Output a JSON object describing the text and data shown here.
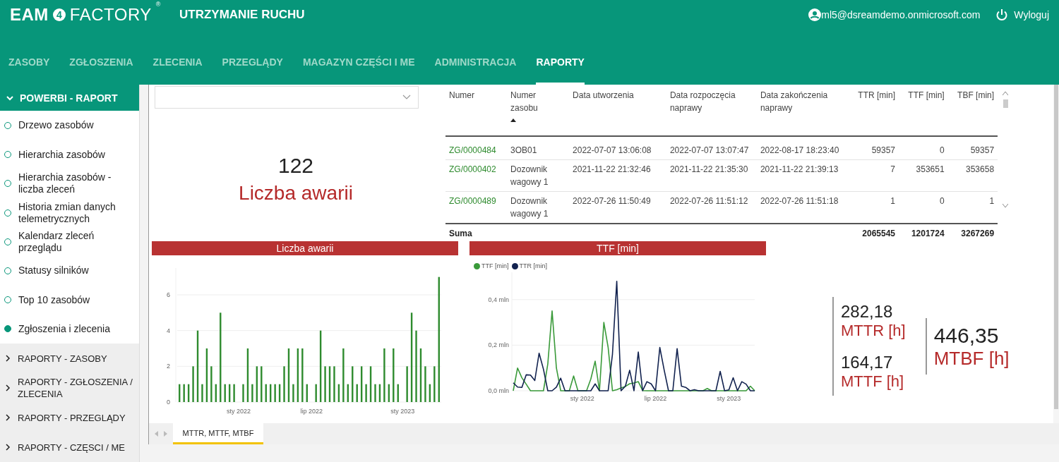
{
  "header": {
    "logo": {
      "left": "EAM",
      "mark": "4",
      "right": "FACTORY",
      "registered": "®"
    },
    "title": "UTRZYMANIE RUCHU",
    "user": "ml5@dsreamdemo.onmicrosoft.com",
    "logout": "Wyloguj"
  },
  "nav": [
    {
      "label": "ZASOBY",
      "selected": false
    },
    {
      "label": "ZGŁOSZENIA",
      "selected": false
    },
    {
      "label": "ZLECENIA",
      "selected": false
    },
    {
      "label": "PRZEGLĄDY",
      "selected": false
    },
    {
      "label": "MAGAZYN CZĘŚCI I ME",
      "selected": false
    },
    {
      "label": "ADMINISTRACJA",
      "selected": false
    },
    {
      "label": "RAPORTY",
      "selected": true
    }
  ],
  "sidebar": {
    "section": {
      "label": "POWERBI - RAPORT",
      "expanded": true
    },
    "items": [
      {
        "label": "Drzewo zasobów",
        "selected": false
      },
      {
        "label": "Hierarchia zasobów",
        "selected": false
      },
      {
        "label": "Hierarchia zasobów - liczba zleceń",
        "selected": false
      },
      {
        "label": "Historia zmian danych telemetrycznych",
        "selected": false
      },
      {
        "label": "Kalendarz zleceń przeglądu",
        "selected": false
      },
      {
        "label": "Statusy silników",
        "selected": false
      },
      {
        "label": "Top 10 zasobów",
        "selected": false
      },
      {
        "label": "Zgłoszenia i zlecenia",
        "selected": true
      }
    ],
    "groups": [
      {
        "label": "RAPORTY - ZASOBY",
        "expanded": false
      },
      {
        "label": "RAPORTY - ZGŁOSZENIA / ZLECENIA",
        "expanded": false
      },
      {
        "label": "RAPORTY - PRZEGLĄDY",
        "expanded": false
      },
      {
        "label": "RAPORTY - CZĘSCI / ME",
        "expanded": false
      }
    ]
  },
  "kpi": {
    "value": "122",
    "label": "Liczba awarii"
  },
  "table": {
    "columns": [
      {
        "label": "Numer",
        "kind": "text"
      },
      {
        "label": "Numer zasobu",
        "kind": "text",
        "sorted": true
      },
      {
        "label": "Data utworzenia",
        "kind": "text"
      },
      {
        "label": "Data rozpoczęcia naprawy",
        "kind": "text"
      },
      {
        "label": "Data zakończenia naprawy",
        "kind": "text"
      },
      {
        "label": "TTR [min]",
        "kind": "number"
      },
      {
        "label": "TTF [min]",
        "kind": "number"
      },
      {
        "label": "TBF [min]",
        "kind": "number"
      }
    ],
    "rows": [
      [
        "ZG/0000484",
        "3OB01",
        "2022-07-07 13:06:08",
        "2022-07-07 13:07:47",
        "2022-08-17 18:23:40",
        "59357",
        "0",
        "59357"
      ],
      [
        "ZG/0000402",
        "Dozownik wagowy 1",
        "2021-11-22 21:32:46",
        "2021-11-22 21:35:30",
        "2021-11-22 21:39:13",
        "7",
        "353651",
        "353658"
      ],
      [
        "ZG/0000489",
        "Dozownik wagowy 1",
        "2022-07-26 11:50:49",
        "2022-07-26 11:51:12",
        "2022-07-26 11:51:18",
        "1",
        "0",
        "1"
      ]
    ],
    "total": {
      "label": "Suma",
      "values": [
        "2065545",
        "1201724",
        "3267269"
      ]
    }
  },
  "bar_chart": {
    "title": "Liczba awarii",
    "chart_data": {
      "type": "bar",
      "categories": [
        null,
        null,
        null,
        null,
        null,
        null,
        null,
        null,
        null,
        null,
        null,
        null,
        null,
        "sty 2022",
        null,
        null,
        null,
        null,
        null,
        null,
        null,
        null,
        null,
        null,
        null,
        null,
        null,
        null,
        null,
        "lip 2022",
        null,
        null,
        null,
        null,
        null,
        null,
        null,
        null,
        null,
        null,
        null,
        null,
        null,
        null,
        null,
        null,
        null,
        null,
        null,
        "sty 2023",
        null,
        null,
        null,
        null,
        null,
        null,
        null,
        null
      ],
      "series": [
        {
          "color": "#2e8b2e",
          "values": [
            1,
            1,
            1,
            2,
            4,
            1,
            3,
            2,
            1,
            5,
            1,
            1,
            1,
            0,
            1,
            3,
            1,
            2,
            2,
            1,
            1,
            1,
            1,
            2,
            3,
            1,
            3,
            3,
            1,
            0,
            1,
            4,
            2,
            2,
            2,
            1,
            3,
            1,
            2,
            1,
            2,
            1,
            2,
            1,
            1,
            3,
            1,
            3,
            1,
            0,
            2,
            5,
            4,
            3,
            2,
            1,
            2,
            7
          ]
        }
      ],
      "grid": true,
      "ylim": [
        0,
        7.5
      ],
      "yticks": [
        0,
        2,
        4,
        6
      ]
    }
  },
  "line_chart": {
    "title": "TTF [min]",
    "chart_data": {
      "type": "line",
      "grid": true,
      "ylim": [
        0,
        0.52
      ],
      "yticks": [
        {
          "value": 0,
          "label": "0,0 mln"
        },
        {
          "value": 0.2,
          "label": "0,2 mln"
        },
        {
          "value": 0.4,
          "label": "0,4 mln"
        }
      ],
      "categories": [
        null,
        null,
        null,
        null,
        null,
        null,
        null,
        null,
        null,
        null,
        null,
        null,
        null,
        null,
        null,
        null,
        "sty 2022",
        null,
        null,
        null,
        null,
        null,
        null,
        null,
        null,
        null,
        null,
        null,
        null,
        null,
        null,
        null,
        null,
        "lip 2022",
        null,
        null,
        null,
        null,
        null,
        null,
        null,
        null,
        null,
        null,
        null,
        null,
        null,
        null,
        null,
        null,
        "sty 2023",
        null,
        null,
        null,
        null,
        null,
        null
      ],
      "series": [
        {
          "name": "TTF [min]",
          "color": "#3a9a3a",
          "values": [
            0,
            0.1,
            0.057,
            0.029,
            0,
            0,
            0,
            0,
            0.117,
            0.35,
            0.1,
            0,
            0,
            0,
            0.065,
            0,
            0,
            0,
            0.052,
            0.13,
            0,
            0.3,
            0.19,
            0,
            0.005,
            0.012,
            0.019,
            0.031,
            0.034,
            0.04,
            0.001,
            0,
            0,
            0,
            0,
            0,
            0,
            0,
            0,
            0,
            0,
            0,
            0,
            0,
            0,
            0.01,
            0,
            0,
            0,
            0,
            0,
            0,
            0,
            0,
            0,
            0.02,
            0
          ]
        },
        {
          "name": "TTR [min]",
          "color": "#12224f",
          "values": [
            0.035,
            0.016,
            0.015,
            0.07,
            0.069,
            0.045,
            0.165,
            0.094,
            0,
            0,
            0.016,
            0.055,
            0,
            0,
            0,
            0,
            0,
            0,
            0,
            0.03,
            0,
            0,
            0,
            0.16,
            0.48,
            0,
            0.02,
            0.09,
            0,
            0.17,
            0,
            0.04,
            0.03,
            0,
            0.19,
            0.09,
            0,
            0,
            0.185,
            0.02,
            0.015,
            0,
            0.005,
            0,
            0,
            0,
            0,
            0,
            0.085,
            0,
            0.004,
            0.057,
            0,
            0.04,
            0.029,
            0,
            0
          ]
        }
      ]
    }
  },
  "metrics": [
    {
      "value": "282,18",
      "label": "MTTR [h]"
    },
    {
      "value": "164,17",
      "label": "MTTF [h]"
    },
    {
      "value": "446,35",
      "label": "MTBF [h]"
    }
  ],
  "page_tabs": [
    {
      "label": "MTTR, MTTF, MTBF",
      "selected": true
    }
  ]
}
